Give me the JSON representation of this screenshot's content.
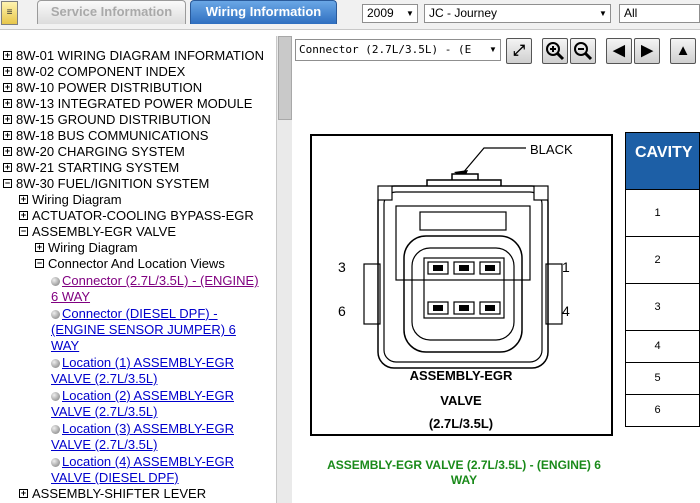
{
  "toolbar_top": {
    "tabs": [
      "Service Information",
      "Wiring Information"
    ],
    "year": "2009",
    "model": "JC - Journey",
    "filter": "All"
  },
  "tree": {
    "top_items": [
      "8W-01 WIRING DIAGRAM INFORMATION",
      "8W-02 COMPONENT INDEX",
      "8W-10 POWER DISTRIBUTION",
      "8W-13 INTEGRATED POWER MODULE",
      "8W-15 GROUND DISTRIBUTION",
      "8W-18 BUS COMMUNICATIONS",
      "8W-20 CHARGING SYSTEM",
      "8W-21 STARTING SYSTEM",
      "8W-30 FUEL/IGNITION SYSTEM"
    ],
    "sub_items": [
      "Wiring Diagram",
      "ACTUATOR-COOLING BYPASS-EGR",
      "ASSEMBLY-EGR VALVE"
    ],
    "egr_children": [
      "Wiring Diagram",
      "Connector And Location Views"
    ],
    "links": [
      [
        "Connector (2.7L/3.5L) - (ENGINE)",
        "6 WAY"
      ],
      [
        "Connector (DIESEL DPF) -",
        "(ENGINE SENSOR JUMPER) 6",
        "WAY"
      ],
      [
        "Location (1) ASSEMBLY-EGR",
        "VALVE (2.7L/3.5L)"
      ],
      [
        "Location (2) ASSEMBLY-EGR",
        "VALVE (2.7L/3.5L)"
      ],
      [
        "Location (3) ASSEMBLY-EGR",
        "VALVE (2.7L/3.5L)"
      ],
      [
        "Location (4) ASSEMBLY-EGR",
        "VALVE (DIESEL DPF)"
      ]
    ],
    "last_item": "ASSEMBLY-SHIFTER LEVER"
  },
  "viewer": {
    "connector_select": "Connector (2.7L/3.5L) - (E",
    "buttons": [
      "fit-icon",
      "zoom-in-icon",
      "zoom-out-icon",
      "previous-icon",
      "next-icon",
      "home-icon"
    ],
    "diagram": {
      "color_label": "BLACK",
      "pin_left_top": "3",
      "pin_left_bottom": "6",
      "pin_right_top": "1",
      "pin_right_bottom": "4",
      "title_line1": "ASSEMBLY-EGR",
      "title_line2": "VALVE",
      "title_line3": "(2.7L/3.5L)"
    },
    "caption_line1": "ASSEMBLY-EGR VALVE (2.7L/3.5L) - (ENGINE) 6",
    "caption_line2": "WAY",
    "cavity_header": "CAVITY",
    "cavities": [
      "1",
      "2",
      "3",
      "4",
      "5",
      "6"
    ]
  }
}
